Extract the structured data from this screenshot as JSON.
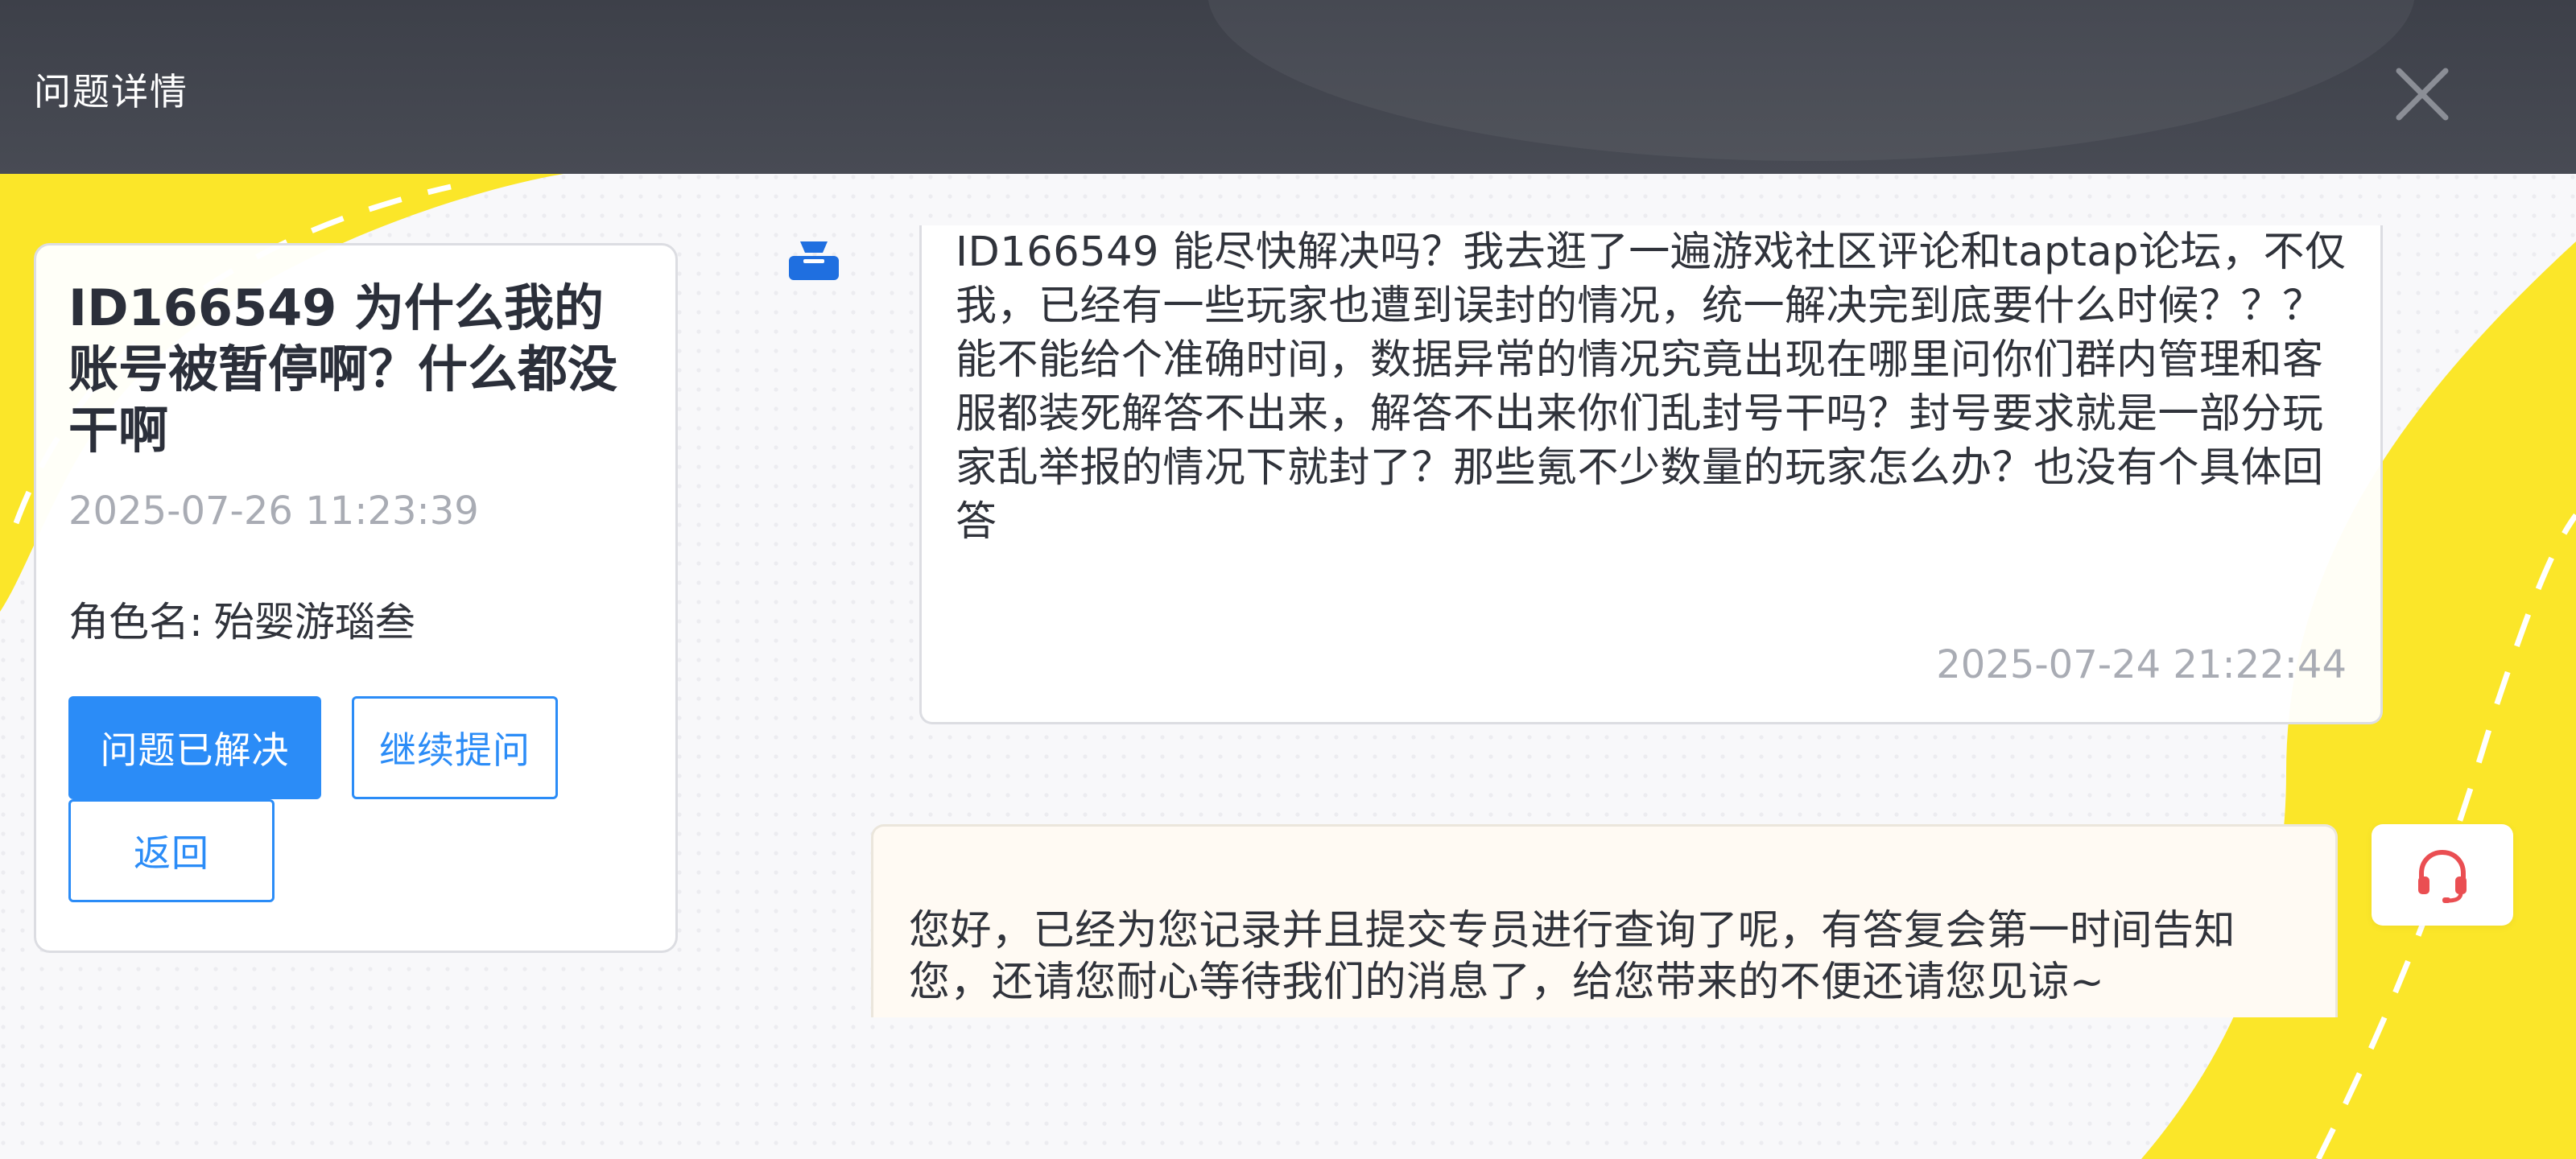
{
  "header": {
    "title": "问题详情",
    "close_icon": "close-icon"
  },
  "question": {
    "title": "ID166549 为什么我的账号被暂停啊？什么都没干啊",
    "time": "2025-07-26 11:23:39",
    "role_label": "角色名:",
    "role_name": "殆婴游瑙叁"
  },
  "actions": {
    "solved_label": "问题已解决",
    "continue_label": "继续提问",
    "back_label": "返回"
  },
  "conversation": {
    "user_message": {
      "avatar_icon": "user-avatar-icon",
      "text": "ID166549 能尽快解决吗？我去逛了一遍游戏社区评论和taptap论坛，不仅我，已经有一些玩家也遭到误封的情况，统一解决完到底要什么时候？？？能不能给个准确时间，数据异常的情况究竟出现在哪里问你们群内管理和客服都装死解答不出来，解答不出来你们乱封号干吗？封号要求就是一部分玩家乱举报的情况下就封了？那些氪不少数量的玩家怎么办？也没有个具体回答",
      "time": "2025-07-24 21:22:44"
    },
    "reply_message": {
      "text": "您好，已经为您记录并且提交专员进行查询了呢，有答复会第一时间告知您，还请您耐心等待我们的消息了，给您带来的不便还请您见谅~"
    },
    "support_icon": "headset-icon"
  },
  "colors": {
    "header_bg": "#41444d",
    "accent_blue": "#2b8cf7",
    "decor_yellow": "#fbe629",
    "support_red": "#ea4e52"
  }
}
